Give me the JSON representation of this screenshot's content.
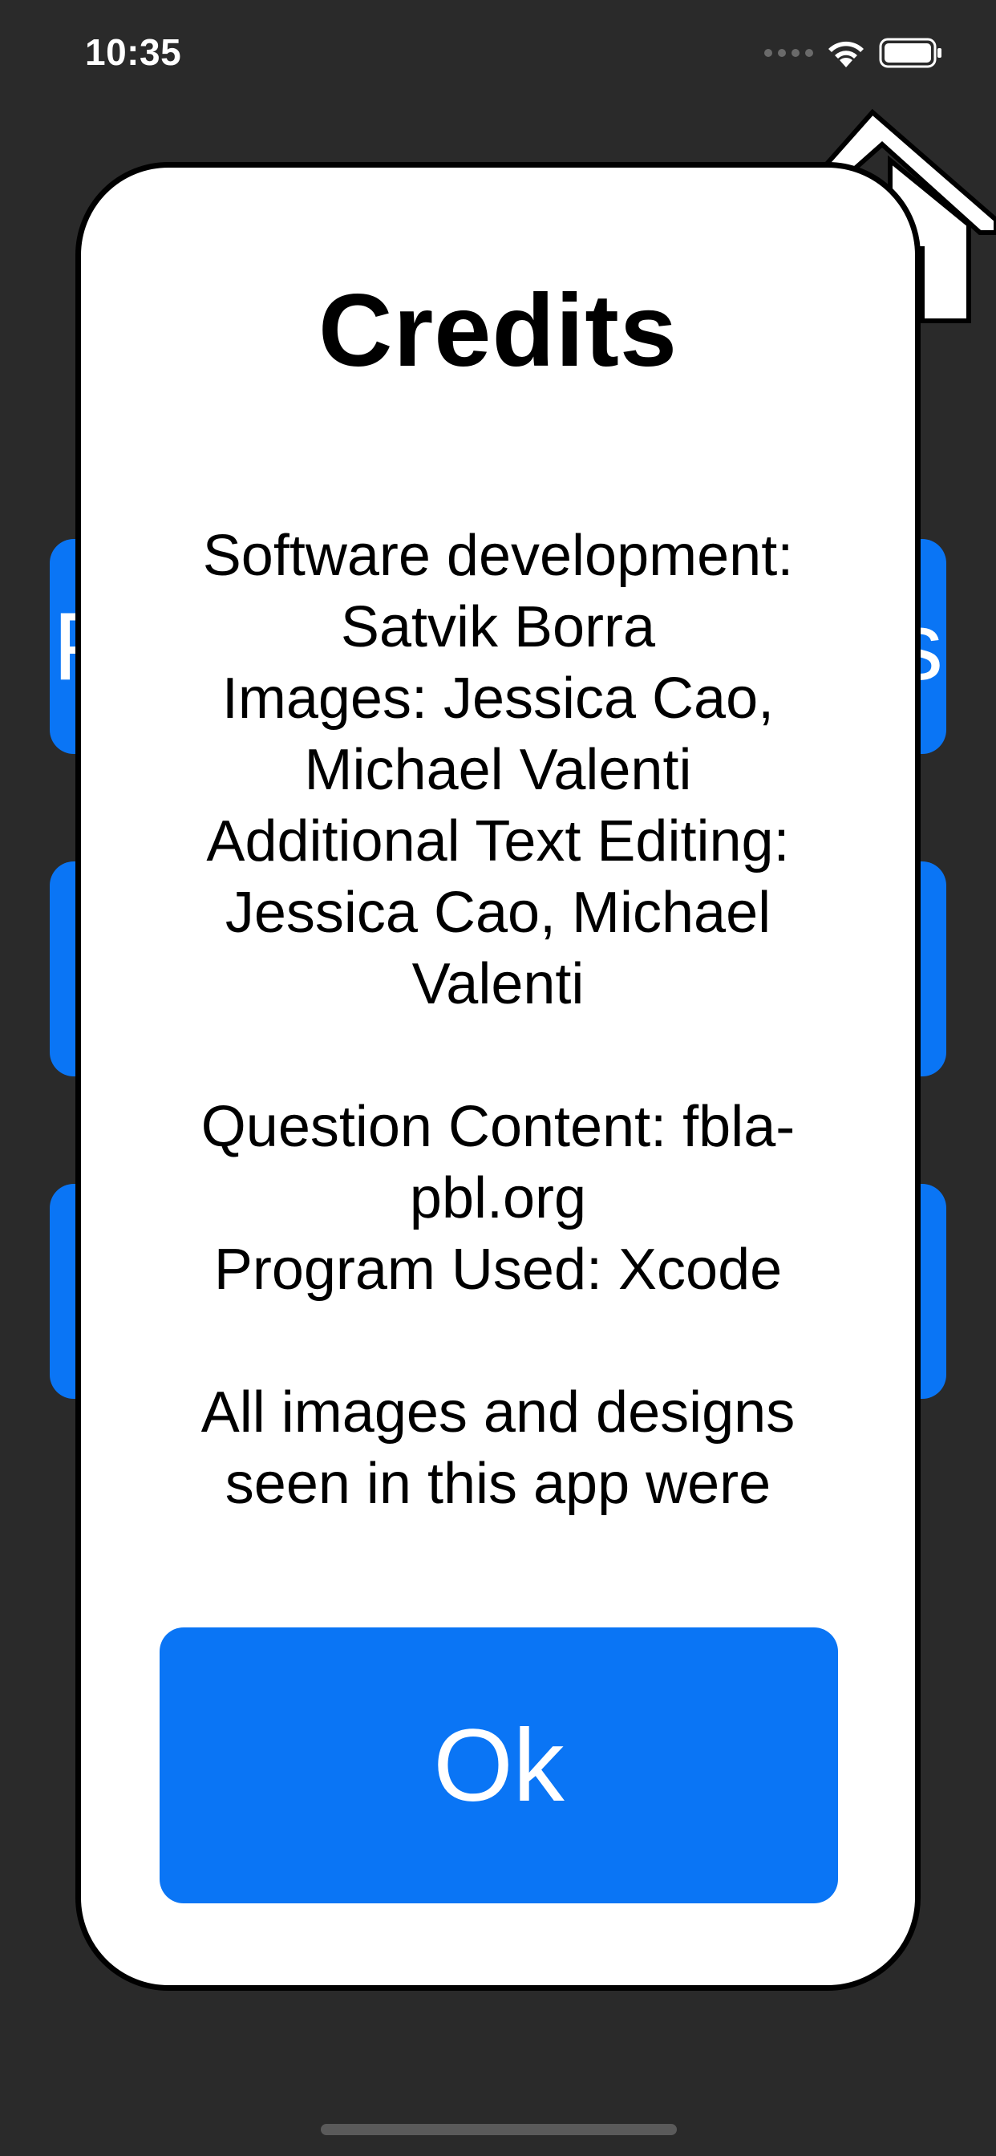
{
  "status_bar": {
    "time": "10:35",
    "icons": [
      "cellular-signal-icon",
      "wifi-icon",
      "battery-icon"
    ]
  },
  "background": {
    "color": "#2a2a2a",
    "buttons": [
      {
        "left_label": "P",
        "right_label": "s"
      },
      {
        "left_label": "",
        "right_label": ""
      },
      {
        "left_label": "",
        "right_label": ""
      }
    ]
  },
  "top_right_icon": "home-icon",
  "dialog": {
    "title": "Credits",
    "body": "Software development: Satvik Borra\nImages: Jessica Cao, Michael Valenti\nAdditional Text Editing: Jessica Cao, Michael Valenti\n\nQuestion Content: fbla-pbl.org\nProgram Used: Xcode\n\nAll images and designs seen in this app were created specifically for",
    "ok_label": "Ok"
  },
  "colors": {
    "accent_blue": "#0a75f5",
    "dialog_background": "#ffffff",
    "dialog_border": "#000000"
  }
}
